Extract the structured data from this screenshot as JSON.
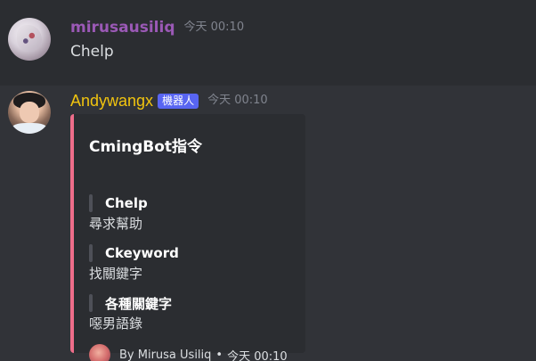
{
  "messages": [
    {
      "username": "mirusausiliq",
      "timestamp": "今天 00:10",
      "content": "Chelp"
    },
    {
      "username": "Andywangx",
      "bot_tag": "機器人",
      "timestamp": "今天 00:10",
      "embed": {
        "title": "CmingBot指令",
        "fields": [
          {
            "name": "Chelp",
            "value": "尋求幫助"
          },
          {
            "name": "Ckeyword",
            "value": "找關鍵字"
          },
          {
            "name": "各種關鍵字",
            "value": "噁男語錄"
          }
        ],
        "footer_text": "By Mirusa Usiliq",
        "footer_separator": "•",
        "footer_timestamp": "今天 00:10"
      }
    }
  ],
  "colors": {
    "background": "#313338",
    "highlight_row": "#2b2d31",
    "user1": "#9b59b6",
    "user2": "#f1c40f",
    "bot_tag": "#5865f2",
    "embed_accent": "#ee6d8a"
  }
}
